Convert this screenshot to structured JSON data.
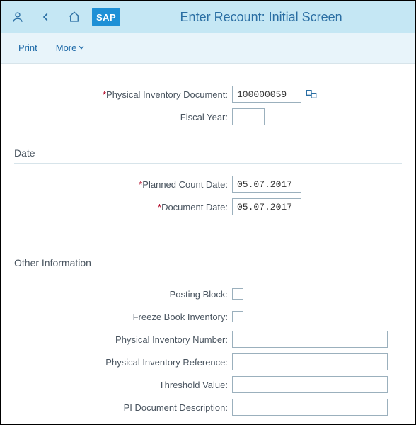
{
  "header": {
    "title": "Enter Recount: Initial Screen",
    "logo_text": "SAP"
  },
  "toolbar": {
    "print_label": "Print",
    "more_label": "More"
  },
  "form": {
    "pid_label": "Physical Inventory Document:",
    "pid_value": "100000059",
    "fy_label": "Fiscal Year:",
    "fy_value": ""
  },
  "sections": {
    "date_head": "Date",
    "other_head": "Other Information"
  },
  "date": {
    "planned_label": "Planned Count Date:",
    "planned_value": "05.07.2017",
    "docdate_label": "Document Date:",
    "docdate_value": "05.07.2017"
  },
  "other": {
    "posting_block_label": "Posting Block:",
    "freeze_label": "Freeze Book Inventory:",
    "pin_label": "Physical Inventory Number:",
    "pin_value": "",
    "pir_label": "Physical Inventory Reference:",
    "pir_value": "",
    "thresh_label": "Threshold Value:",
    "thresh_value": "",
    "desc_label": "PI Document Description:",
    "desc_value": ""
  }
}
